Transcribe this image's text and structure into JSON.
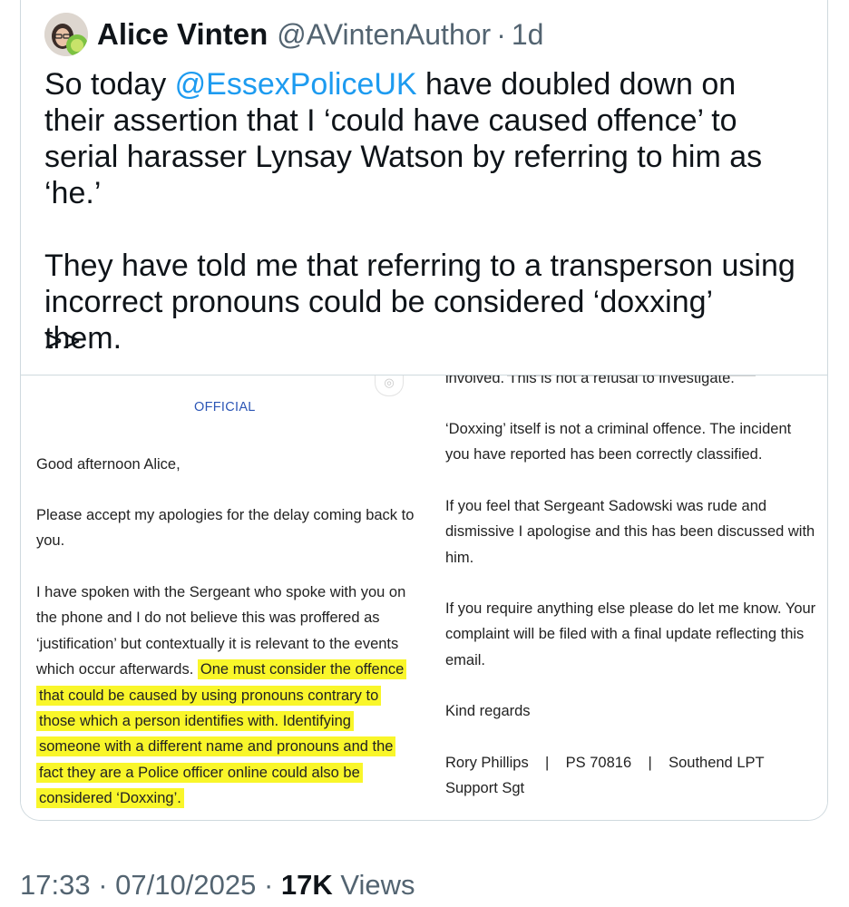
{
  "tweet": {
    "author_name": "Alice Vinten",
    "handle": "@AVintenAuthor",
    "separator": "·",
    "age": "1d",
    "line1_a": "So today ",
    "mention": "@EssexPoliceUK",
    "line1_b": " have doubled down on their assertion that I ‘could have caused offence’ to serial harasser Lynsay Watson by referring to him as ‘he.’",
    "paragraph2": "They have told me that referring to a transperson using incorrect pronouns could be considered ‘doxxing’ them.",
    "more_marker": ">>"
  },
  "letter": {
    "official_label": "OFFICIAL",
    "greeting": "Good afternoon Alice,",
    "para1": "Please accept my apologies for the delay coming back to you.",
    "para2_plain": "I have spoken with the Sergeant who spoke with you on the phone and I do not believe this was proffered as ‘justification’ but contextually it is relevant to the events which occur afterwards.",
    "para2_highlight": "One must consider the offence that could be caused by using pronouns contrary to those which a person identifies with. Identifying someone with a different name and pronouns and the fact they are a Police officer online could also be considered ‘Doxxing’.",
    "right_para1": "involved. This is not a refusal to investigate.",
    "right_para2": "‘Doxxing’ itself is not a criminal offence. The incident you have reported has been correctly classified.",
    "right_para3": "If you feel that Sergeant Sadowski was rude and dismissive I apologise and this has been discussed with him.",
    "right_para4": "If you require anything else please do let me know. Your complaint will be filed with a final update reflecting this email.",
    "signoff": "Kind regards",
    "signature": "Rory Phillips    |    PS 70816    |    Southend LPT Support Sgt",
    "highlight_color": "#f9f62a"
  },
  "footer": {
    "time": "17:33",
    "date": "07/10/2025",
    "separator": "·",
    "views_count": "17K",
    "views_label": "Views"
  },
  "colors": {
    "mention": "#1d9bf0",
    "muted": "#536471",
    "official": "#2b55b5"
  }
}
